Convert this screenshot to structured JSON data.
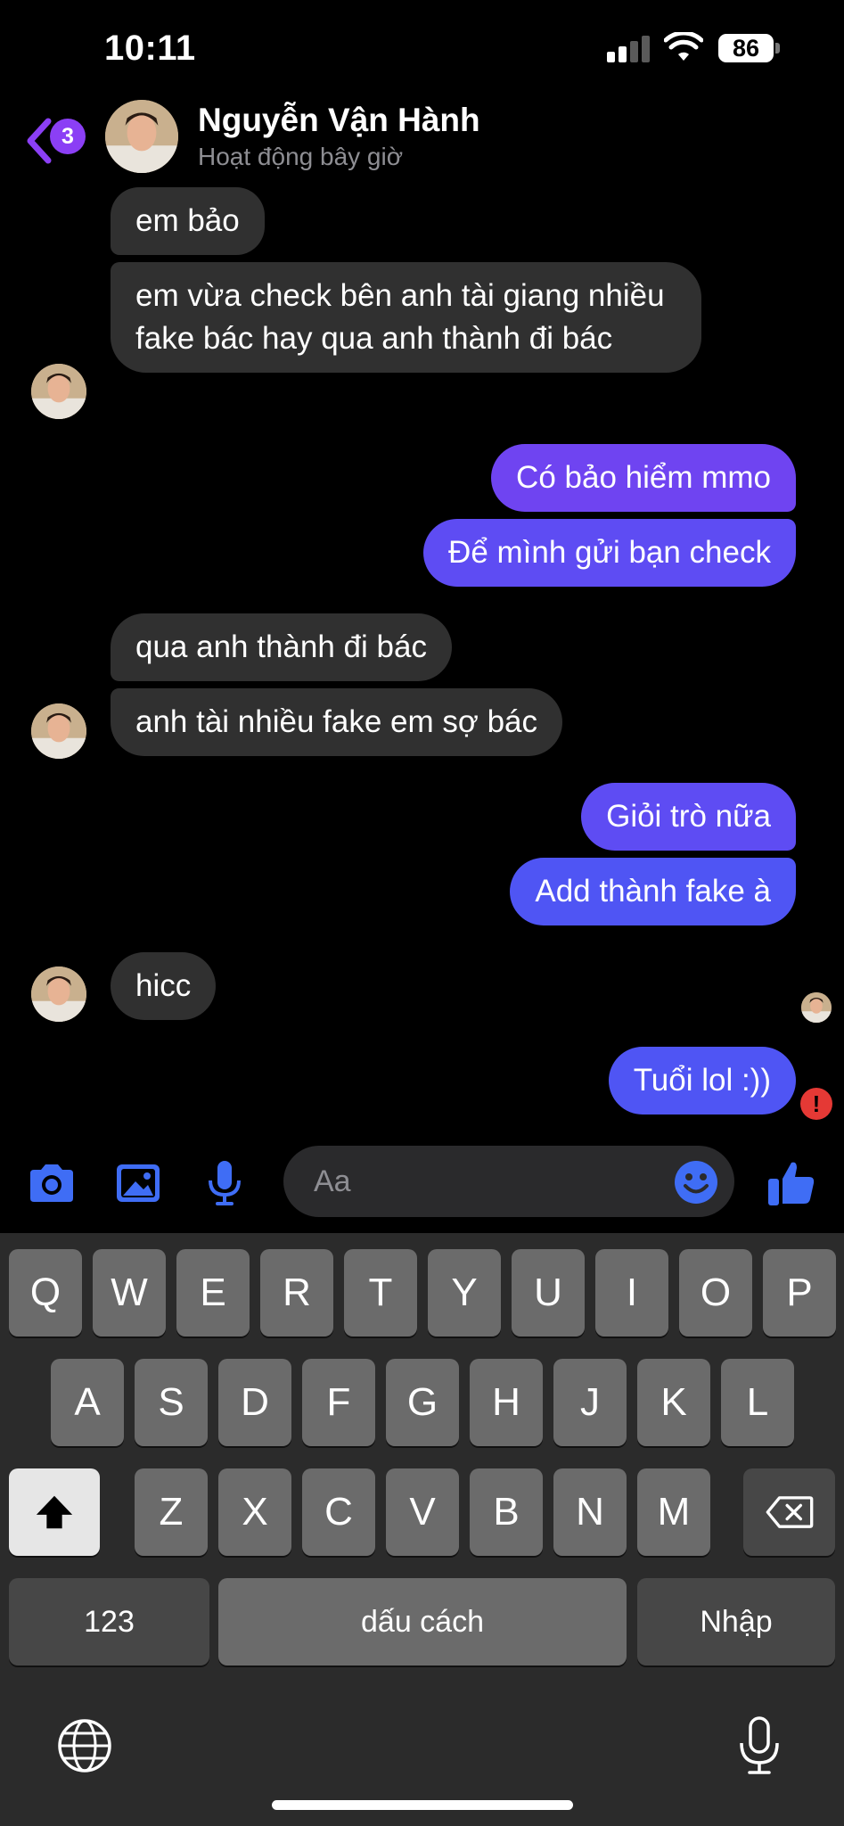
{
  "status_bar": {
    "time": "10:11",
    "battery": "86"
  },
  "header": {
    "unread_count": "3",
    "contact_name": "Nguyễn Vận Hành",
    "contact_status": "Hoạt động bây giờ"
  },
  "messages": [
    {
      "sender": "contact",
      "text": "em bảo"
    },
    {
      "sender": "contact",
      "text": "em vừa check bên anh tài giang nhiều fake bác hay qua anh thành đi bác"
    },
    {
      "sender": "me",
      "text": "Có bảo hiểm mmo"
    },
    {
      "sender": "me",
      "text": "Để mình gửi bạn check"
    },
    {
      "sender": "contact",
      "text": "qua anh thành đi bác"
    },
    {
      "sender": "contact",
      "text": "anh tài nhiều fake em sợ bác"
    },
    {
      "sender": "me",
      "text": "Giỏi trò nữa"
    },
    {
      "sender": "me",
      "text": "Add thành fake à"
    },
    {
      "sender": "contact",
      "text": "hicc"
    },
    {
      "sender": "me",
      "text": "Tuổi lol :))",
      "error": true
    }
  ],
  "composer": {
    "placeholder": "Aa"
  },
  "keyboard": {
    "row1": [
      "Q",
      "W",
      "E",
      "R",
      "T",
      "Y",
      "U",
      "I",
      "O",
      "P"
    ],
    "row2": [
      "A",
      "S",
      "D",
      "F",
      "G",
      "H",
      "J",
      "K",
      "L"
    ],
    "row3": [
      "Z",
      "X",
      "C",
      "V",
      "B",
      "N",
      "M"
    ],
    "numbers_label": "123",
    "space_label": "dấu cách",
    "return_label": "Nhập"
  },
  "colors": {
    "accent": "#8b3ff5",
    "incoming_bubble": "#303030",
    "outgoing_bubble_top": "#6f44f1",
    "outgoing_bubble_bottom": "#4f55f4",
    "icon_blue": "#3f6df5",
    "error_red": "#e53935"
  },
  "icons": [
    "back-chevron-icon",
    "camera-icon",
    "image-icon",
    "microphone-icon",
    "emoji-icon",
    "thumbs-up-icon",
    "error-icon",
    "globe-icon",
    "shift-icon",
    "backspace-icon"
  ]
}
